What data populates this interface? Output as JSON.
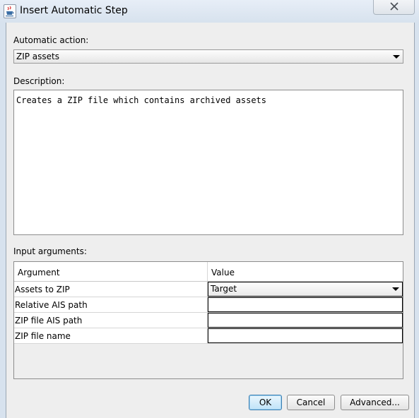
{
  "window": {
    "title": "Insert Automatic Step",
    "app_icon": "java-cup-icon",
    "close_glyph": "X"
  },
  "automatic_action": {
    "label": "Automatic action:",
    "selected": "ZIP assets"
  },
  "description": {
    "label": "Description:",
    "text": "Creates a ZIP file which contains archived assets"
  },
  "input_arguments": {
    "label": "Input arguments:",
    "columns": [
      "Argument",
      "Value"
    ],
    "rows": [
      {
        "argument": "Assets to ZIP",
        "value": "Target"
      },
      {
        "argument": "Relative AIS path",
        "value": ""
      },
      {
        "argument": "ZIP file AIS path",
        "value": ""
      },
      {
        "argument": "ZIP file name",
        "value": ""
      }
    ]
  },
  "buttons": {
    "ok": "OK",
    "cancel": "Cancel",
    "advanced": "Advanced..."
  }
}
